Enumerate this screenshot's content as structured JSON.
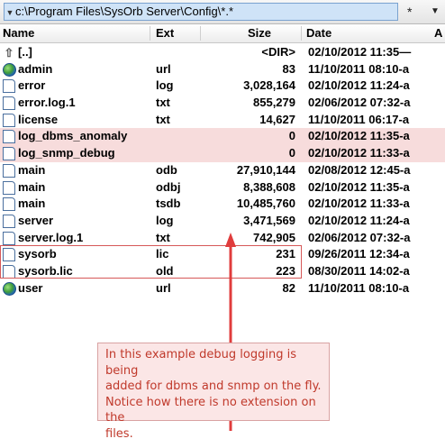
{
  "path_bar": {
    "path": "c:\\Program Files\\SysOrb Server\\Config\\*.*",
    "filter_label": "*",
    "dropdown_icon": "chevron-down-icon"
  },
  "columns": {
    "name": "Name",
    "ext": "Ext",
    "size": "Size",
    "date": "Date",
    "attr": "A"
  },
  "rows": [
    {
      "icon": "up-folder-icon",
      "name": "[..]",
      "ext": "",
      "size": "<DIR>",
      "date": "02/10/2012 11:35—"
    },
    {
      "icon": "globe-icon",
      "name": "admin",
      "ext": "url",
      "size": "83",
      "date": "11/10/2011 08:10-a"
    },
    {
      "icon": "file-icon",
      "name": "error",
      "ext": "log",
      "size": "3,028,164",
      "date": "02/10/2012 11:24-a"
    },
    {
      "icon": "file-icon",
      "name": "error.log.1",
      "ext": "txt",
      "size": "855,279",
      "date": "02/06/2012 07:32-a"
    },
    {
      "icon": "file-icon",
      "name": "license",
      "ext": "txt",
      "size": "14,627",
      "date": "11/10/2011 06:17-a"
    },
    {
      "icon": "file-icon",
      "name": "log_dbms_anomaly",
      "ext": "",
      "size": "0",
      "date": "02/10/2012 11:35-a"
    },
    {
      "icon": "file-icon",
      "name": "log_snmp_debug",
      "ext": "",
      "size": "0",
      "date": "02/10/2012 11:33-a"
    },
    {
      "icon": "file-icon",
      "name": "main",
      "ext": "odb",
      "size": "27,910,144",
      "date": "02/08/2012 12:45-a"
    },
    {
      "icon": "file-icon",
      "name": "main",
      "ext": "odbj",
      "size": "8,388,608",
      "date": "02/10/2012 11:35-a"
    },
    {
      "icon": "file-icon",
      "name": "main",
      "ext": "tsdb",
      "size": "10,485,760",
      "date": "02/10/2012 11:33-a"
    },
    {
      "icon": "file-icon",
      "name": "server",
      "ext": "log",
      "size": "3,471,569",
      "date": "02/10/2012 11:24-a"
    },
    {
      "icon": "file-icon",
      "name": "server.log.1",
      "ext": "txt",
      "size": "742,905",
      "date": "02/06/2012 07:32-a"
    },
    {
      "icon": "file-icon",
      "name": "sysorb",
      "ext": "lic",
      "size": "231",
      "date": "09/26/2011 12:34-a"
    },
    {
      "icon": "file-icon",
      "name": "sysorb.lic",
      "ext": "old",
      "size": "223",
      "date": "08/30/2011 14:02-a"
    },
    {
      "icon": "globe-icon",
      "name": "user",
      "ext": "url",
      "size": "82",
      "date": "11/10/2011 08:10-a"
    }
  ],
  "annotation": {
    "lines": [
      "In this example debug logging is being",
      "added for dbms and snmp on the fly.",
      "Notice how there is no extension on the",
      "files."
    ],
    "color": "#c0392b"
  },
  "colors": {
    "highlight_fill": "#f7dcdc",
    "highlight_border": "#d65858",
    "arrow": "#e03c3c",
    "path_bar": "#cfe3f7"
  }
}
